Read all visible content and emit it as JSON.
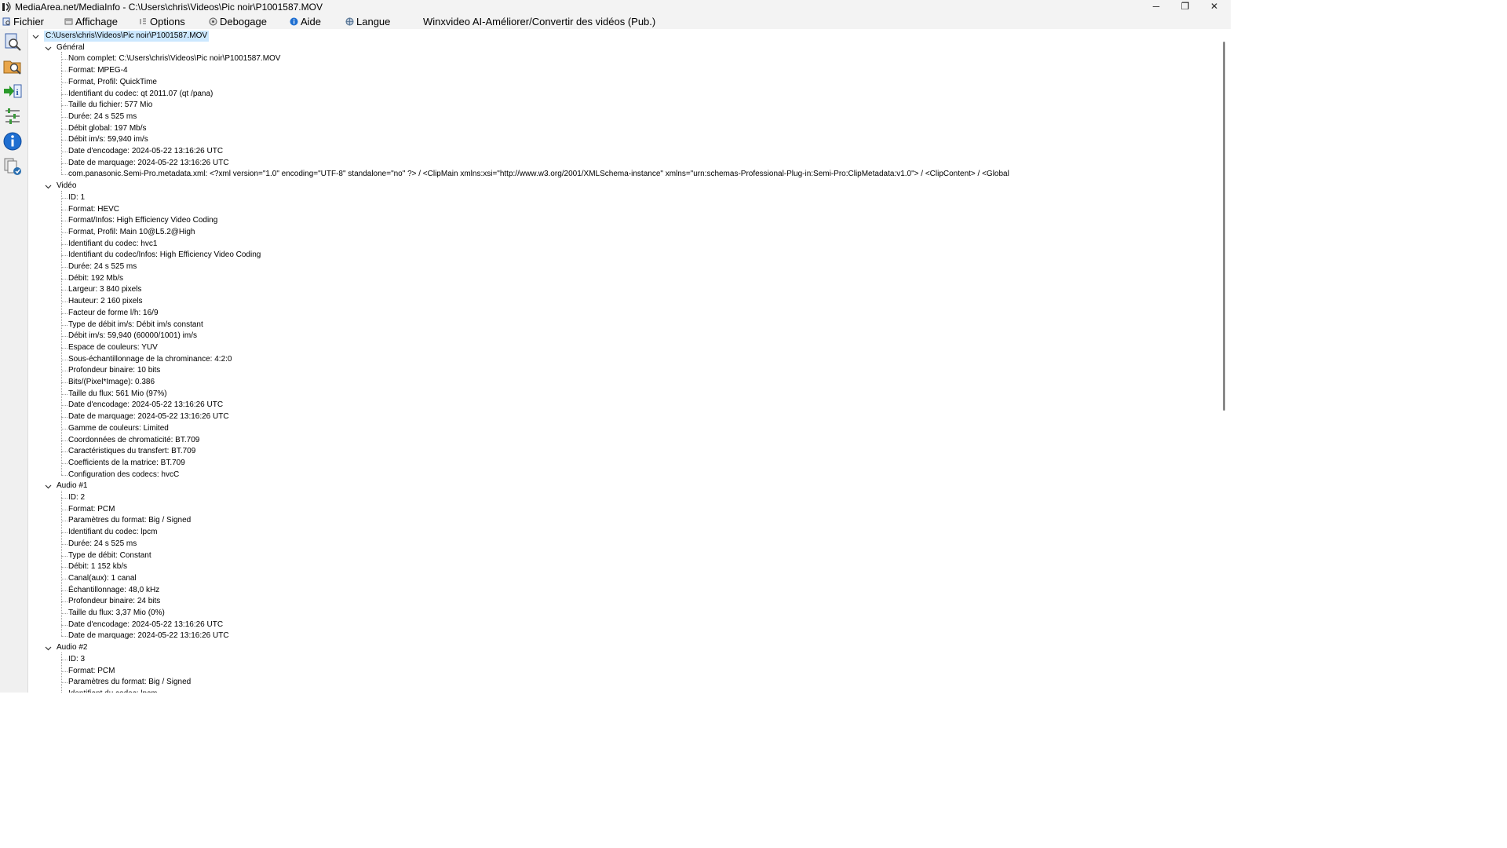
{
  "window": {
    "title": "MediaArea.net/MediaInfo - C:\\Users\\chris\\Videos\\Pic noir\\P1001587.MOV",
    "minimize": "─",
    "restore": "❐",
    "close": "✕"
  },
  "menu": [
    {
      "label": "Fichier",
      "icon": "file-icon"
    },
    {
      "label": "Affichage",
      "icon": "view-icon"
    },
    {
      "label": "Options",
      "icon": "options-icon"
    },
    {
      "label": "Debogage",
      "icon": "debug-icon"
    },
    {
      "label": "Aide",
      "icon": "help-icon"
    },
    {
      "label": "Langue",
      "icon": "language-icon"
    },
    {
      "label": "Winxvideo AI-Améliorer/Convertir des vidéos (Pub.)",
      "icon": ""
    }
  ],
  "toolbar": [
    {
      "name": "open-file-icon",
      "color": "#3a5fa8"
    },
    {
      "name": "open-folder-icon",
      "color": "#d98a2b"
    },
    {
      "name": "export-icon",
      "color": "#2a8a2a"
    },
    {
      "name": "preferences-icon",
      "color": "#7a7a7a"
    },
    {
      "name": "about-icon",
      "color": "#1f6fd1"
    },
    {
      "name": "knowledge-base-icon",
      "color": "#2a6fb0"
    }
  ],
  "tree": {
    "root": "C:\\Users\\chris\\Videos\\Pic noir\\P1001587.MOV",
    "sections": [
      {
        "title": "Général",
        "items": [
          "Nom complet: C:\\Users\\chris\\Videos\\Pic noir\\P1001587.MOV",
          "Format: MPEG-4",
          "Format, Profil: QuickTime",
          "Identifiant du codec: qt   2011.07 (qt  /pana)",
          "Taille du fichier: 577 Mio",
          "Durée: 24 s 525 ms",
          "Débit global: 197 Mb/s",
          "Débit im/s: 59,940 im/s",
          "Date d'encodage: 2024-05-22 13:16:26 UTC",
          "Date de marquage: 2024-05-22 13:16:26 UTC",
          "com.panasonic.Semi-Pro.metadata.xml: <?xml version=\"1.0\" encoding=\"UTF-8\" standalone=\"no\" ?> / <ClipMain xmlns:xsi=\"http://www.w3.org/2001/XMLSchema-instance\" xmlns=\"urn:schemas-Professional-Plug-in:Semi-Pro:ClipMetadata:v1.0\"> /   <ClipContent> /     <Global"
        ]
      },
      {
        "title": "Vidéo",
        "items": [
          "ID: 1",
          "Format: HEVC",
          "Format/Infos: High Efficiency Video Coding",
          "Format, Profil: Main 10@L5.2@High",
          "Identifiant du codec: hvc1",
          "Identifiant du codec/Infos: High Efficiency Video Coding",
          "Durée: 24 s 525 ms",
          "Débit: 192 Mb/s",
          "Largeur: 3 840 pixels",
          "Hauteur: 2 160 pixels",
          "Facteur de forme l/h: 16/9",
          "Type de débit im/s: Débit im/s constant",
          "Débit im/s: 59,940 (60000/1001) im/s",
          "Espace de couleurs: YUV",
          "Sous-échantillonnage de la chrominance: 4:2:0",
          "Profondeur binaire: 10 bits",
          "Bits/(Pixel*Image): 0.386",
          "Taille du flux: 561 Mio (97%)",
          "Date d'encodage: 2024-05-22 13:16:26 UTC",
          "Date de marquage: 2024-05-22 13:16:26 UTC",
          "Gamme de couleurs: Limited",
          "Coordonnées de chromaticité: BT.709",
          "Caractéristiques du transfert: BT.709",
          "Coefficients de la matrice: BT.709",
          "Configuration des codecs: hvcC"
        ]
      },
      {
        "title": "Audio #1",
        "items": [
          "ID: 2",
          "Format: PCM",
          "Paramètres du format: Big / Signed",
          "Identifiant du codec: lpcm",
          "Durée: 24 s 525 ms",
          "Type de débit: Constant",
          "Débit: 1 152 kb/s",
          "Canal(aux): 1 canal",
          "Échantillonnage: 48,0 kHz",
          "Profondeur binaire: 24 bits",
          "Taille du flux: 3,37 Mio (0%)",
          "Date d'encodage: 2024-05-22 13:16:26 UTC",
          "Date de marquage: 2024-05-22 13:16:26 UTC"
        ]
      },
      {
        "title": "Audio #2",
        "items": [
          "ID: 3",
          "Format: PCM",
          "Paramètres du format: Big / Signed",
          "Identifiant du codec: lpcm"
        ]
      }
    ]
  }
}
